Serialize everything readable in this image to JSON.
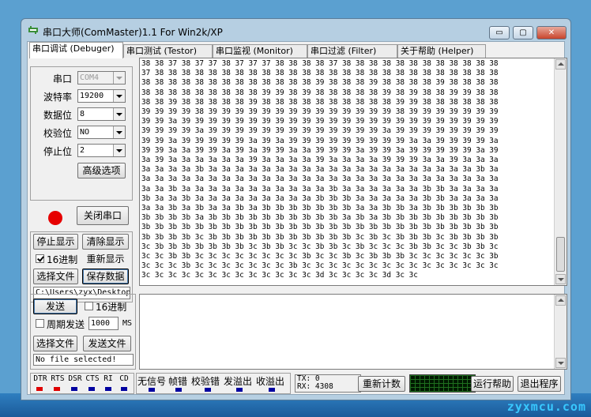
{
  "window": {
    "title": "串口大师(ComMaster)1.1 For Win2k/XP",
    "minimize_label": "▭",
    "maximize_label": "▢",
    "close_label": "✕"
  },
  "tabs": [
    {
      "label": "串口调试 (Debuger)"
    },
    {
      "label": "串口测试 (Testor)"
    },
    {
      "label": "串口监视 (Monitor)"
    },
    {
      "label": "串口过滤 (Filter)"
    },
    {
      "label": "关于帮助 (Helper)"
    }
  ],
  "settings": {
    "port_label": "串口",
    "port_value": "COM4",
    "baud_label": "波特率",
    "baud_value": "19200",
    "databits_label": "数据位",
    "databits_value": "8",
    "parity_label": "校验位",
    "parity_value": "NO",
    "stopbits_label": "停止位",
    "stopbits_value": "2",
    "advanced_label": "高级选项"
  },
  "port_control": {
    "close_port_label": "关闭串口",
    "status_color": "#e60000"
  },
  "receive_controls": {
    "stop_display_label": "停止显示",
    "clear_display_label": "清除显示",
    "hex_label": "16进制",
    "hex_checked": true,
    "redisplay_label": "重新显示",
    "choose_file_label": "选择文件",
    "save_data_label": "保存数据",
    "save_path": "C:\\Users\\zyx\\Desktop"
  },
  "receive_lines": [
    "38 38 37 38 37 37 38 37 37 37 38 38 38 38 37 38 38 38 38 38 38 38 38 38 38 38 38",
    "37 38 38 38 38 38 38 38 38 38 38 38 38 38 38 38 38 38 38 38 38 38 38 38 38 38 38",
    "38 38 38 38 38 38 38 38 38 38 38 38 38 39 38 38 38 39 38 38 38 38 39 38 38 38 38",
    "38 38 38 38 38 38 38 38 38 39 39 38 39 38 38 38 38 38 39 38 39 38 38 39 39 38 38",
    "38 38 39 38 38 38 38 38 39 38 38 38 38 38 38 38 38 38 38 39 39 38 38 38 38 38 38",
    "39 39 39 39 38 39 39 39 39 39 39 39 39 39 39 39 39 39 39 38 39 39 39 39 39 39 39",
    "39 39 3a 39 39 39 39 39 39 39 39 39 39 39 39 39 39 39 39 39 39 39 39 39 39 39 39",
    "39 39 39 39 3a 39 39 39 39 39 39 39 39 39 39 39 39 39 3a 39 39 39 39 39 39 39 39",
    "39 39 3a 39 39 39 39 39 3a 39 3a 39 39 39 39 39 39 39 39 39 3a 3a 39 39 39 39 3a",
    "39 39 3a 3a 39 39 3a 39 3a 39 39 3a 3a 39 39 39 3a 39 39 3a 39 39 39 39 39 3a 39",
    "3a 39 3a 3a 3a 3a 3a 3a 39 3a 3a 3a 3a 39 3a 3a 3a 3a 39 39 39 3a 3a 39 3a 3a 3a",
    "3a 3a 3a 3a 3b 3a 3a 3a 3a 3a 3a 3a 3a 3a 3a 3a 3a 3a 3a 3a 3a 3a 3a 3a 3a 3b 3a",
    "3a 3a 3a 3a 3a 3a 3a 3a 3a 3a 3a 3a 3a 3a 3a 3a 3a 3a 3a 3a 3a 3a 3a 3a 3a 3a 3a",
    "3a 3a 3b 3a 3a 3a 3a 3a 3a 3a 3a 3a 3a 3a 3b 3a 3a 3a 3a 3a 3a 3b 3b 3a 3a 3a 3a",
    "3b 3a 3a 3b 3a 3a 3a 3a 3a 3a 3a 3a 3a 3b 3b 3b 3a 3a 3a 3a 3a 3b 3b 3a 3a 3a 3a",
    "3a 3a 3b 3a 3b 3a 3a 3b 3a 3b 3b 3b 3b 3b 3b 3b 3a 3a 3b 3b 3a 3b 3b 3b 3b 3b 3b",
    "3b 3b 3b 3b 3a 3b 3b 3b 3b 3b 3b 3b 3b 3b 3b 3a 3b 3a 3b 3b 3b 3b 3b 3b 3b 3b 3b",
    "3b 3b 3b 3b 3b 3b 3b 3b 3b 3b 3b 3b 3b 3b 3b 3b 3b 3b 3b 3b 3b 3b 3b 3b 3b 3b 3b",
    "3b 3b 3b 3b 3c 3b 3b 3b 3b 3b 3b 3b 3b 3b 3b 3b 3c 3b 3c 3b 3b 3b 3c 3b 3b 3b 3b",
    "3c 3b 3b 3b 3b 3b 3b 3b 3c 3b 3b 3c 3c 3b 3b 3c 3b 3c 3c 3c 3b 3b 3c 3c 3b 3b 3c",
    "3c 3c 3b 3b 3c 3c 3c 3c 3c 3c 3c 3c 3b 3c 3c 3b 3c 3b 3b 3b 3c 3c 3c 3c 3c 3c 3b",
    "3c 3c 3c 3b 3c 3c 3c 3c 3c 3c 3c 3b 3c 3c 3c 3c 3c 3c 3c 3c 3c 3c 3c 3c 3c 3c 3c",
    "3c 3c 3c 3c 3c 3c 3c 3c 3c 3c 3c 3c 3c 3d 3c 3c 3c 3c 3d 3c 3c"
  ],
  "send_controls": {
    "send_label": "发送",
    "hex_label": "16进制",
    "hex_checked": false,
    "periodic_label": "周期发送",
    "periodic_checked": false,
    "period_value": "1000",
    "period_unit": "MS",
    "choose_file_label": "选择文件",
    "send_file_label": "发送文件",
    "file_status": "No file selected!"
  },
  "status_bar": {
    "signals": [
      {
        "label": "DTR",
        "color": "#e00000"
      },
      {
        "label": "RTS",
        "color": "#e00000"
      },
      {
        "label": "DSR",
        "color": "#0000a0"
      },
      {
        "label": "CTS",
        "color": "#0000a0"
      },
      {
        "label": "RI",
        "color": "#0000a0"
      },
      {
        "label": "CD",
        "color": "#0000a0"
      }
    ],
    "errors": [
      {
        "label": "无信号",
        "color": "#0000a0"
      },
      {
        "label": "帧错",
        "color": "#0000a0"
      },
      {
        "label": "校验错",
        "color": "#0000a0"
      },
      {
        "label": "发溢出",
        "color": "#0000a0"
      },
      {
        "label": "收溢出",
        "color": "#0000a0"
      }
    ],
    "tx_label": "TX:",
    "tx_value": "0",
    "rx_label": "RX:",
    "rx_value": "4308",
    "reset_count_label": "重新计数",
    "help_label": "运行帮助",
    "exit_label": "退出程序"
  },
  "watermark": "zyxmcu.com"
}
